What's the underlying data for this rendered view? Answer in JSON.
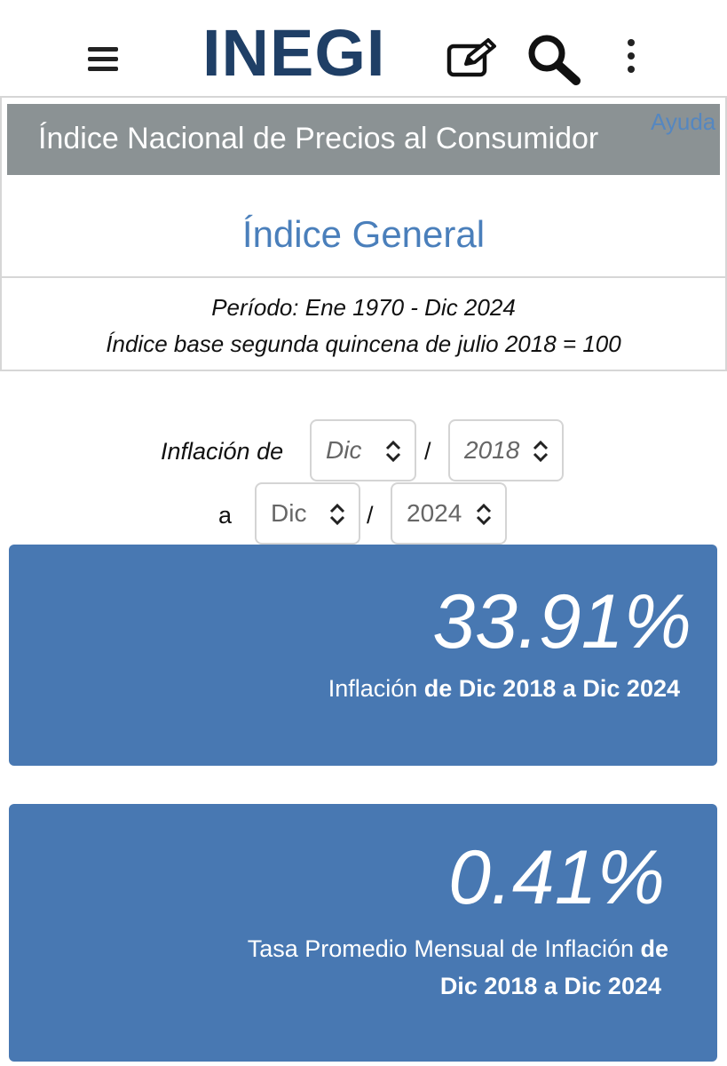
{
  "header": {
    "logo_text": "INEGI",
    "icons": [
      "hamburger-menu-icon",
      "edit-icon",
      "search-icon",
      "kebab-menu-icon"
    ]
  },
  "panel": {
    "title": "Índice Nacional de Precios al Consumidor",
    "help_label": "Ayuda",
    "subtitle": "Índice General",
    "period": "Período: Ene 1970 - Dic 2024",
    "base": "Índice base segunda quincena de julio 2018 = 100"
  },
  "form": {
    "from_label": "Inflación de",
    "to_label": "a",
    "separator": "/",
    "from_month": "Dic",
    "from_year": "2018",
    "to_month": "Dic",
    "to_year": "2024"
  },
  "results": {
    "inflation_value": "33.91%",
    "inflation_caption_prefix": "Inflación ",
    "inflation_caption_bold": "de Dic 2018 a Dic 2024",
    "monthly_value": "0.41%",
    "monthly_caption_prefix": "Tasa Promedio Mensual de Inflación ",
    "monthly_caption_bold_1": "de",
    "monthly_caption_bold_2": "Dic 2018 a Dic 2024"
  },
  "colors": {
    "card": "#4878b2",
    "title_bar": "#8b9294",
    "subtitle": "#4a7fbb",
    "logo": "#1f3f66"
  }
}
